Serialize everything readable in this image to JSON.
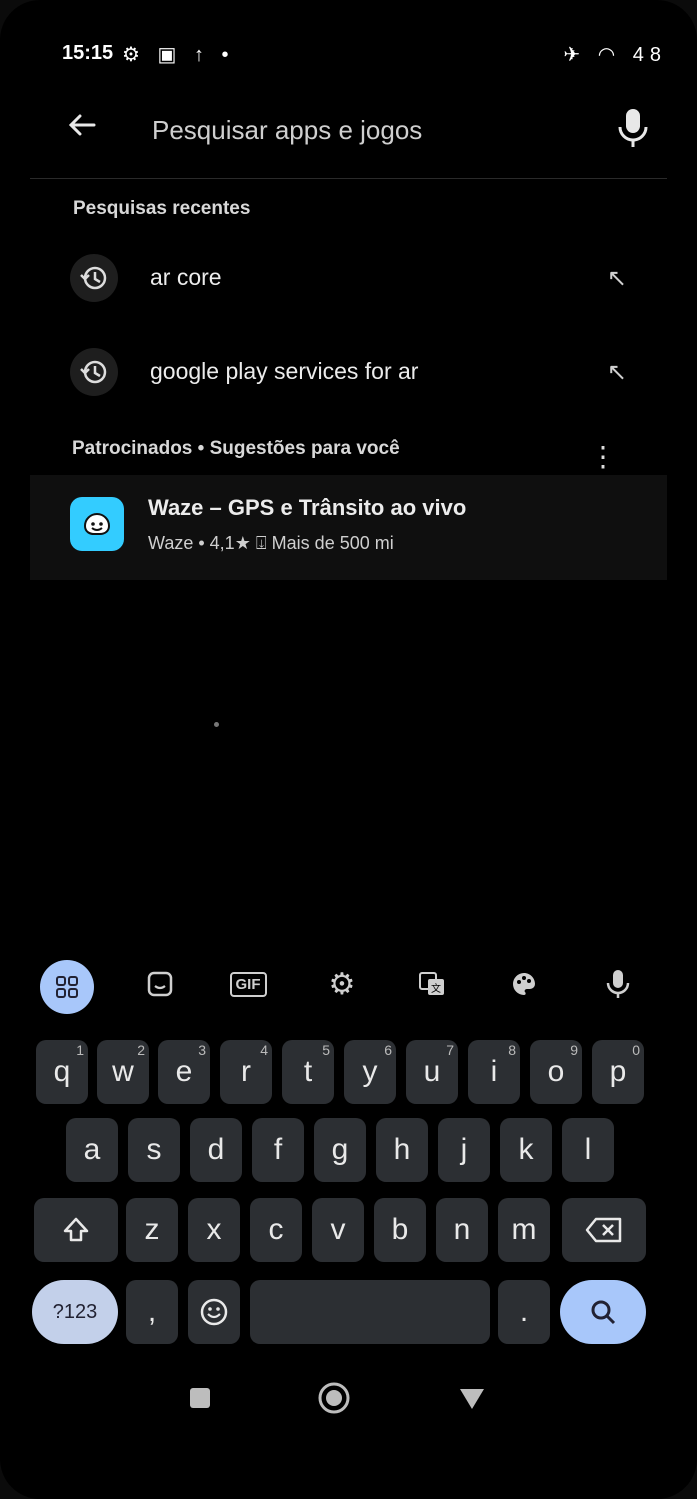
{
  "status_bar": {
    "time": "15:15",
    "left_icons": "⚙ ▣ ↑ •",
    "right_icons": "✈ ◠ 48"
  },
  "search": {
    "placeholder": "Pesquisar apps e jogos"
  },
  "recent": {
    "title": "Pesquisas recentes",
    "items": [
      {
        "label": "ar core"
      },
      {
        "label": "google play services for ar"
      }
    ]
  },
  "suggestions": {
    "title": "Patrocinados • Sugestões para você",
    "app": {
      "name": "Waze – GPS e Trânsito ao vivo",
      "developer": "Waze",
      "rating": "4,1★",
      "downloads": "Mais de 500 mi"
    }
  },
  "keyboard": {
    "row1": [
      [
        "q",
        "1"
      ],
      [
        "w",
        "2"
      ],
      [
        "e",
        "3"
      ],
      [
        "r",
        "4"
      ],
      [
        "t",
        "5"
      ],
      [
        "y",
        "6"
      ],
      [
        "u",
        "7"
      ],
      [
        "i",
        "8"
      ],
      [
        "o",
        "9"
      ],
      [
        "p",
        "0"
      ]
    ],
    "row2": [
      "a",
      "s",
      "d",
      "f",
      "g",
      "h",
      "j",
      "k",
      "l"
    ],
    "row3": [
      "z",
      "x",
      "c",
      "v",
      "b",
      "n",
      "m"
    ],
    "sym_label": "?123",
    "comma": ",",
    "period": "."
  },
  "toolbar": {
    "icons": [
      "apps-grid-icon",
      "sticker-icon",
      "gif-icon",
      "settings-icon",
      "translate-icon",
      "palette-icon",
      "mic-icon"
    ],
    "gif_label": "GIF"
  },
  "colors": {
    "accent": "#a8c7fa",
    "background": "#000000",
    "key": "#2c2f33"
  }
}
